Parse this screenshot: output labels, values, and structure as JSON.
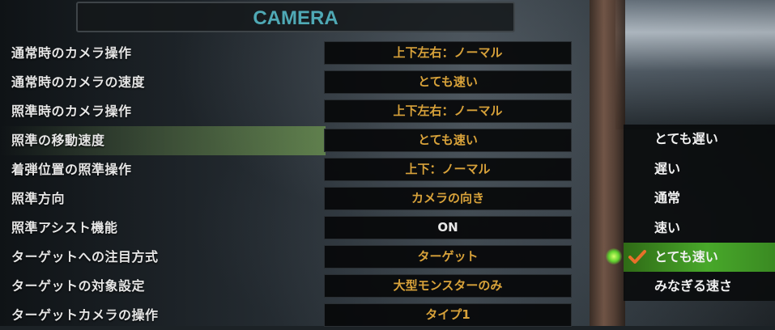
{
  "header": {
    "title": "CAMERA"
  },
  "settings": [
    {
      "label": "通常時のカメラ操作",
      "value": "上下左右：ノーマル"
    },
    {
      "label": "通常時のカメラの速度",
      "value": "とても速い"
    },
    {
      "label": "照準時のカメラ操作",
      "value": "上下左右：ノーマル"
    },
    {
      "label": "照準の移動速度",
      "value": "とても速い",
      "selected": true
    },
    {
      "label": "着弾位置の照準操作",
      "value": "上下：ノーマル"
    },
    {
      "label": "照準方向",
      "value": "カメラの向き"
    },
    {
      "label": "照準アシスト機能",
      "value": "ON"
    },
    {
      "label": "ターゲットへの注目方式",
      "value": "ターゲット"
    },
    {
      "label": "ターゲットの対象設定",
      "value": "大型モンスターのみ"
    },
    {
      "label": "ターゲットカメラの操作",
      "value": "タイプ1"
    }
  ],
  "dropdown": {
    "options": [
      "とても遅い",
      "遅い",
      "通常",
      "速い",
      "とても速い",
      "みなぎる速さ"
    ],
    "selected_index": 4
  },
  "colors": {
    "title": "#4fa9b5",
    "value_text": "#d8a23a",
    "selected_option": "#48a82a"
  },
  "icons": {
    "check": "orange-check-icon",
    "cursor": "green-glow-cursor-icon"
  }
}
